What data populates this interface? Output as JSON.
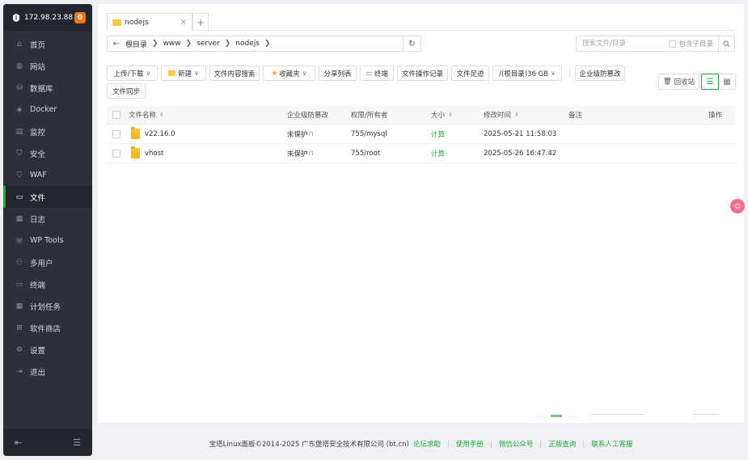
{
  "sidebar": {
    "ip": "172.98.23.88",
    "badge": "0",
    "items": [
      {
        "label": "首页",
        "icon": "home-icon"
      },
      {
        "label": "网站",
        "icon": "globe-icon"
      },
      {
        "label": "数据库",
        "icon": "database-icon"
      },
      {
        "label": "Docker",
        "icon": "docker-icon"
      },
      {
        "label": "监控",
        "icon": "monitor-icon"
      },
      {
        "label": "安全",
        "icon": "shield-icon"
      },
      {
        "label": "WAF",
        "icon": "waf-shield-icon"
      },
      {
        "label": "文件",
        "icon": "folder-icon",
        "active": true
      },
      {
        "label": "日志",
        "icon": "log-icon"
      },
      {
        "label": "WP Tools",
        "icon": "wordpress-icon"
      },
      {
        "label": "多用户",
        "icon": "users-icon"
      },
      {
        "label": "终端",
        "icon": "terminal-icon"
      },
      {
        "label": "计划任务",
        "icon": "calendar-icon"
      },
      {
        "label": "软件商店",
        "icon": "apps-icon"
      },
      {
        "label": "设置",
        "icon": "gear-icon"
      },
      {
        "label": "退出",
        "icon": "logout-icon"
      }
    ]
  },
  "tab": {
    "label": "nodejs",
    "close": "×",
    "add": "+"
  },
  "path": {
    "crumbs": [
      "根目录",
      "www",
      "server",
      "nodejs"
    ]
  },
  "search": {
    "placeholder": "搜索文件/目录",
    "sub_label": "包含子目录"
  },
  "toolbar": {
    "upload": "上传/下载",
    "new": "新建",
    "content_search": "文件内容搜索",
    "favorites": "收藏夹",
    "share_list": "分享列表",
    "terminal": "终端",
    "op_log": "文件操作记录",
    "footprint": "文件足迹",
    "disk": "/(根目录)36 GB",
    "tamper": "企业级防篡改",
    "sync": "文件同步",
    "recycle": "回收站"
  },
  "table": {
    "headers": {
      "name": "文件名称",
      "tamper": "企业级防篡改",
      "perm": "权限/所有者",
      "size": "大小",
      "mtime": "修改时间",
      "note": "备注",
      "op": "操作"
    },
    "rows": [
      {
        "name": "v22.16.0",
        "tamper": "未保护",
        "perm": "755/mysql",
        "size": "计算",
        "mtime": "2025-05-21 11:58:03"
      },
      {
        "name": "vhost",
        "tamper": "未保护",
        "perm": "755/root",
        "size": "计算",
        "mtime": "2025-05-26 16:47:42"
      }
    ]
  },
  "footer": {
    "copyright": "宝塔Linux面板©2014-2025 广东堡塔安全技术有限公司 (bt.cn)",
    "links": [
      "论坛求助",
      "使用手册",
      "微信公众号",
      "正版查询",
      "联系人工客服"
    ]
  },
  "colors": {
    "accent": "#20a53a",
    "badge": "#f0741b",
    "sidebar": "#2c3138"
  }
}
